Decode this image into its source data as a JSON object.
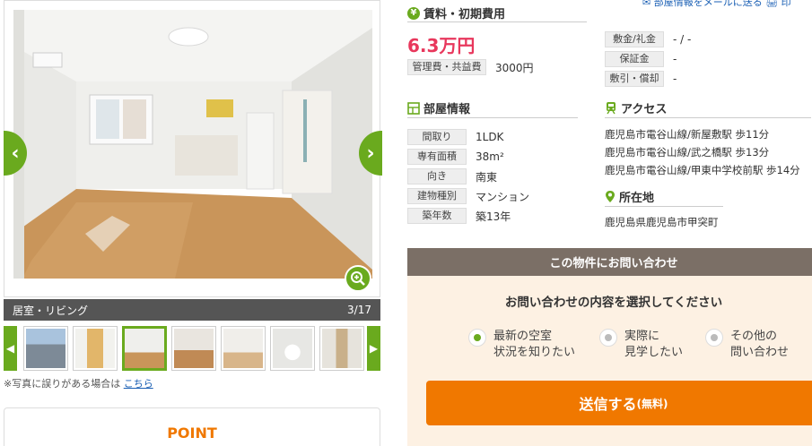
{
  "gallery": {
    "caption": "居室・リビング",
    "counter": "3/17",
    "prev_arrow": "‹",
    "next_arrow": "›",
    "thumb_prev": "◀",
    "thumb_next": "▶",
    "thumbnails": 7,
    "active_thumbnail": 3,
    "accent_color": "#6aaa1e"
  },
  "photo_note": {
    "text": "※写真に誤りがある場合は",
    "link": "こちら"
  },
  "point": {
    "label": "POINT"
  },
  "top_links": {
    "text": "✉ 部屋情報をメールに送る  🖨 印"
  },
  "rent": {
    "heading": "賃料・初期費用",
    "amount": "6.3万円",
    "fee_label": "管理費・共益費",
    "fee_value": "3000円",
    "deposit_label": "敷金/礼金",
    "deposit_value": "- / -",
    "guarantee_label": "保証金",
    "guarantee_value": "-",
    "discount_label": "敷引・償却",
    "discount_value": "-"
  },
  "room": {
    "heading": "部屋情報",
    "rows": [
      {
        "label": "間取り",
        "value": "1LDK"
      },
      {
        "label": "専有面積",
        "value": "38m²"
      },
      {
        "label": "向き",
        "value": "南東"
      },
      {
        "label": "建物種別",
        "value": "マンション"
      },
      {
        "label": "築年数",
        "value": "築13年"
      }
    ]
  },
  "access": {
    "heading": "アクセス",
    "lines": [
      "鹿児島市電谷山線/新屋敷駅 歩11分",
      "鹿児島市電谷山線/武之橋駅 歩13分",
      "鹿児島市電谷山線/甲東中学校前駅 歩14分"
    ]
  },
  "location": {
    "heading": "所在地",
    "address": "鹿児島県鹿児島市甲突町"
  },
  "inquiry": {
    "header": "この物件にお問い合わせ",
    "question": "お問い合わせの内容を選択してください",
    "options": [
      {
        "line1": "最新の空室",
        "line2": "状況を知りたい",
        "selected": true
      },
      {
        "line1": "実際に",
        "line2": "見学したい",
        "selected": false
      },
      {
        "line1": "その他の",
        "line2": "問い合わせ",
        "selected": false
      }
    ],
    "send_label": "送信する",
    "send_suffix": "(無料)",
    "button_color": "#f07800"
  }
}
